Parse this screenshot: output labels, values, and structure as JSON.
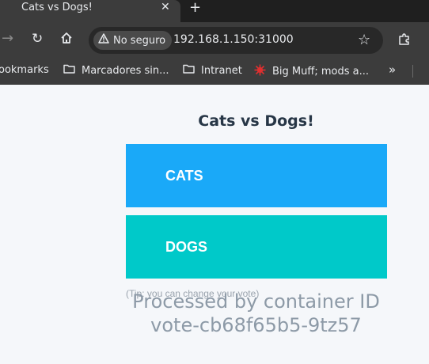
{
  "tab": {
    "title": "Cats vs Dogs!",
    "close_glyph": "✕",
    "new_tab_glyph": "+"
  },
  "toolbar": {
    "forward_glyph": "→",
    "reload_glyph": "↻",
    "security_label": "No seguro",
    "url": "192.168.1.150:31000",
    "bookmark_star_glyph": "☆"
  },
  "bookmarks": {
    "items": [
      {
        "label": "ookmarks",
        "icon": "none"
      },
      {
        "label": "Marcadores sin...",
        "icon": "folder-icon"
      },
      {
        "label": "Intranet",
        "icon": "folder-icon"
      },
      {
        "label": "Big Muff; mods a...",
        "icon": "virus-favicon"
      }
    ],
    "more_glyph": "»"
  },
  "page": {
    "title": "Cats vs Dogs!",
    "option_a": "CATS",
    "option_b": "DOGS",
    "tip": "(Tip: you can change your vote)",
    "processed_line1": "Processed by container ID",
    "processed_line2": "vote-cb68f65b5-9tz57"
  },
  "colors": {
    "cats_button": "#1aa9f8",
    "dogs_button": "#00c9c9",
    "title_text": "#273646",
    "browser_chrome": "#3c3c3c"
  }
}
